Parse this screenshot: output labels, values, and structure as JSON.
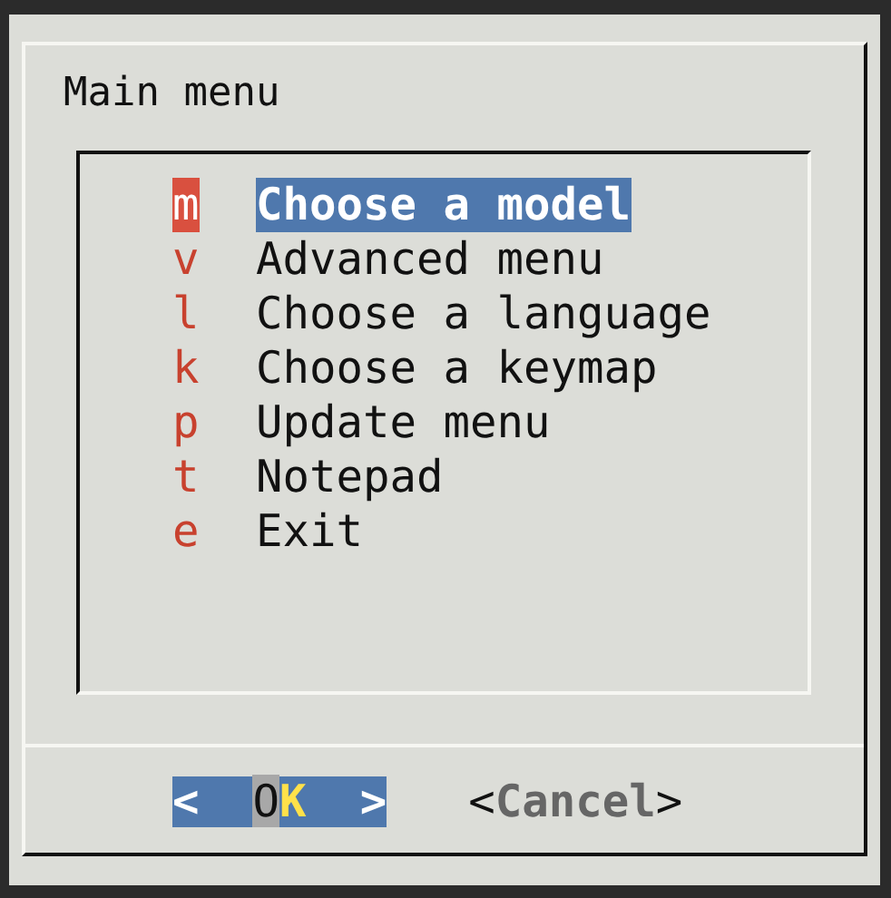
{
  "title": "Main menu",
  "items": [
    {
      "hotkey": "m",
      "label": "Choose a model",
      "selected": true
    },
    {
      "hotkey": "v",
      "label": "Advanced menu",
      "selected": false
    },
    {
      "hotkey": "l",
      "label": "Choose a language",
      "selected": false
    },
    {
      "hotkey": "k",
      "label": "Choose a keymap",
      "selected": false
    },
    {
      "hotkey": "p",
      "label": "Update menu",
      "selected": false
    },
    {
      "hotkey": "t",
      "label": "Notepad",
      "selected": false
    },
    {
      "hotkey": "e",
      "label": "Exit",
      "selected": false
    }
  ],
  "buttons": [
    {
      "open": "<",
      "label": "OK",
      "close": ">",
      "selected": true
    },
    {
      "open": "<",
      "label": "Cancel",
      "close": ">",
      "selected": false
    }
  ]
}
